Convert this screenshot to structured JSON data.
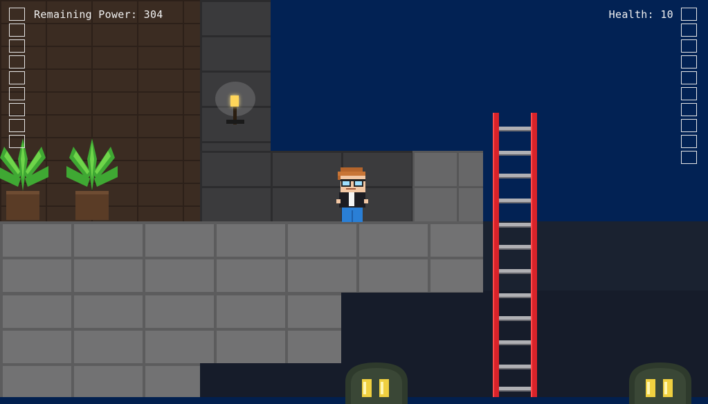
{
  "hud": {
    "power_label": "Remaining Power:",
    "power_value": "304",
    "health_label": "Health:",
    "health_value": "10",
    "power_segments": 9,
    "health_segments": 10
  },
  "colors": {
    "sky": "#022254",
    "ladder_rail": "#d8232a",
    "ladder_rung": "#b0b0b4",
    "stone": "#727273",
    "torch_flame": "#ffd65a",
    "creature_eyes": "#f0d040",
    "hud_text": "#f2f2f2"
  },
  "sprites": {
    "player": "player-character",
    "torch": "wall-torch",
    "plants": [
      "potted-plant",
      "potted-plant"
    ],
    "ladder": "red-ladder",
    "creatures": [
      "shadow-creature",
      "shadow-creature"
    ]
  }
}
